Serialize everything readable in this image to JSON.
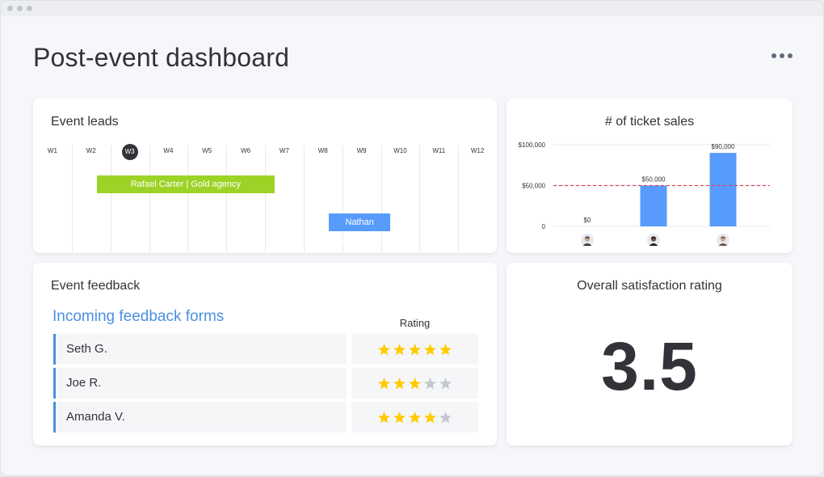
{
  "page": {
    "title": "Post-event dashboard"
  },
  "event_leads": {
    "title": "Event leads",
    "weeks": [
      "W1",
      "W2",
      "W3",
      "W4",
      "W5",
      "W6",
      "W7",
      "W8",
      "W9",
      "W10",
      "W11",
      "W12"
    ],
    "current_week": "W3",
    "bars": [
      {
        "label": "Rafael Carter | Gold agency",
        "start_week": "W2",
        "end_week": "W7",
        "color": "#9cd326"
      },
      {
        "label": "Nathan Cisneros | EPC",
        "start_week": "W8",
        "end_week": "W10",
        "color": "#579bfc"
      }
    ]
  },
  "ticket_sales": {
    "title": "# of ticket sales",
    "chart_data": {
      "type": "bar",
      "title": "# of ticket sales",
      "categories": [
        "person-1",
        "person-2",
        "person-3"
      ],
      "values": [
        0,
        50000,
        90000
      ],
      "value_labels": [
        "$0",
        "$50,000",
        "$90,000"
      ],
      "y_ticks": [
        0,
        50000,
        100000
      ],
      "y_tick_labels": [
        "0",
        "$50,000",
        "$100,000"
      ],
      "ylim": [
        0,
        100000
      ],
      "goal_line": 50000,
      "bar_color": "#579bfc",
      "goal_color": "#e2445c"
    }
  },
  "feedback": {
    "title": "Event feedback",
    "subtitle": "Incoming feedback forms",
    "rating_header": "Rating",
    "rows": [
      {
        "name": "Seth G.",
        "rating": 5
      },
      {
        "name": "Joe R.",
        "rating": 3
      },
      {
        "name": "Amanda V.",
        "rating": 4
      }
    ],
    "max_rating": 5,
    "star_color": "#ffcb00",
    "star_empty_color": "#c5c7d0"
  },
  "satisfaction": {
    "title": "Overall satisfaction rating",
    "value": "3.5"
  }
}
